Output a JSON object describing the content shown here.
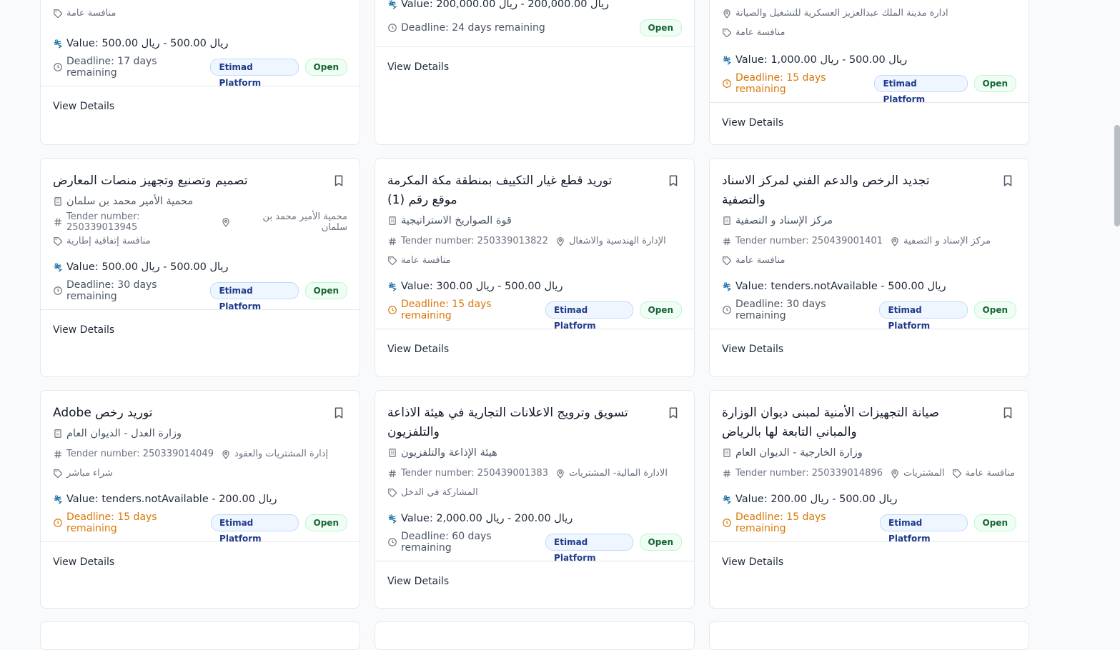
{
  "common": {
    "value_prefix": "Value: ",
    "platform_badge": "Etimad Platform",
    "status_badge": "Open",
    "view_details": "View Details",
    "tender_number_prefix": "Tender number: "
  },
  "row0": [
    {
      "category": "منافسة عامة",
      "value": "Value: 500.00 ريال 500.00 - ريال",
      "deadline": "Deadline: 17 days remaining",
      "deadline_urgent": false
    },
    {
      "value": "Value: 200,000.00 ريال 200,000.00 - ريال",
      "deadline": "Deadline: 24 days remaining",
      "deadline_urgent": false
    },
    {
      "location": "ادارة مدينة الملك عبدالعزيز العسكرية للتشغيل والصيانة",
      "category": "منافسة عامة",
      "value": "Value: 1,000.00 ريال 500.00 - ريال",
      "deadline": "Deadline: 15 days remaining",
      "deadline_urgent": true
    }
  ],
  "row1": [
    {
      "title": "تصميم وتصنيع وتجهيز منصات المعارض",
      "organization": "محمية الأمير محمد بن سلمان",
      "tender_number": "Tender number: 250339013945",
      "location": "محمية الأمير محمد بن سلمان",
      "category": "منافسة إتفاقية إطارية",
      "value": "Value: 500.00 ريال 500.00 - ريال",
      "deadline": "Deadline: 30 days remaining",
      "deadline_urgent": false
    },
    {
      "title": "توريد قطع غيار التكييف بمنطقة مكة المكرمة موقع رقم (1)",
      "organization": "قوة الصواريخ الاستراتيجية",
      "tender_number": "Tender number: 250339013822",
      "location": "الإدارة الهندسية والاشغال",
      "category": "منافسة عامة",
      "value": "Value: 300.00 ريال 500.00 - ريال",
      "deadline": "Deadline: 15 days remaining",
      "deadline_urgent": true
    },
    {
      "title": "تجديد الرخص والدعم الفني لمركز الاسناد والتصفية",
      "organization": "مركز الإسناد و التصفية",
      "tender_number": "Tender number: 250439001401",
      "location": "مركز الإسناد و التصفية",
      "category": "منافسة عامة",
      "value": "Value: tenders.notAvailable - 500.00 ريال",
      "deadline": "Deadline: 30 days remaining",
      "deadline_urgent": false
    }
  ],
  "row2": [
    {
      "title": "توريد رخص Adobe",
      "organization": "وزارة العدل - الديوان العام",
      "tender_number": "Tender number: 250339014049",
      "location": "إدارة المشتريات والعقود",
      "category": "شراء مباشر",
      "value": "Value: tenders.notAvailable - 200.00 ريال",
      "deadline": "Deadline: 15 days remaining",
      "deadline_urgent": true
    },
    {
      "title": "تسويق وترويج الاعلانات التجارية في هيئة الاذاعة والتلفزيون",
      "organization": "هيئة الإذاعة والتلفزيون",
      "tender_number": "Tender number: 250439001383",
      "location": "الادارة المالية- المشتريات",
      "category": "المشاركة في الدخل",
      "value": "Value: 2,000.00 ريال 200.00 - ريال",
      "deadline": "Deadline: 60 days remaining",
      "deadline_urgent": false
    },
    {
      "title": "صيانة التجهيزات الأمنية لمبنى ديوان الوزارة والمباني التابعة لها بالرياض",
      "organization": "وزارة الخارجية - الديوان العام",
      "tender_number": "Tender number: 250339014896",
      "location": "المشتريات",
      "category": "منافسة عامة",
      "value": "Value: 200.00 ريال 500.00 - ريال",
      "deadline": "Deadline: 15 days remaining",
      "deadline_urgent": true
    }
  ],
  "colors": {
    "urgent": "#d97706",
    "open_badge_bg": "#f0fdf4",
    "platform_badge_bg": "#eff6ff"
  }
}
